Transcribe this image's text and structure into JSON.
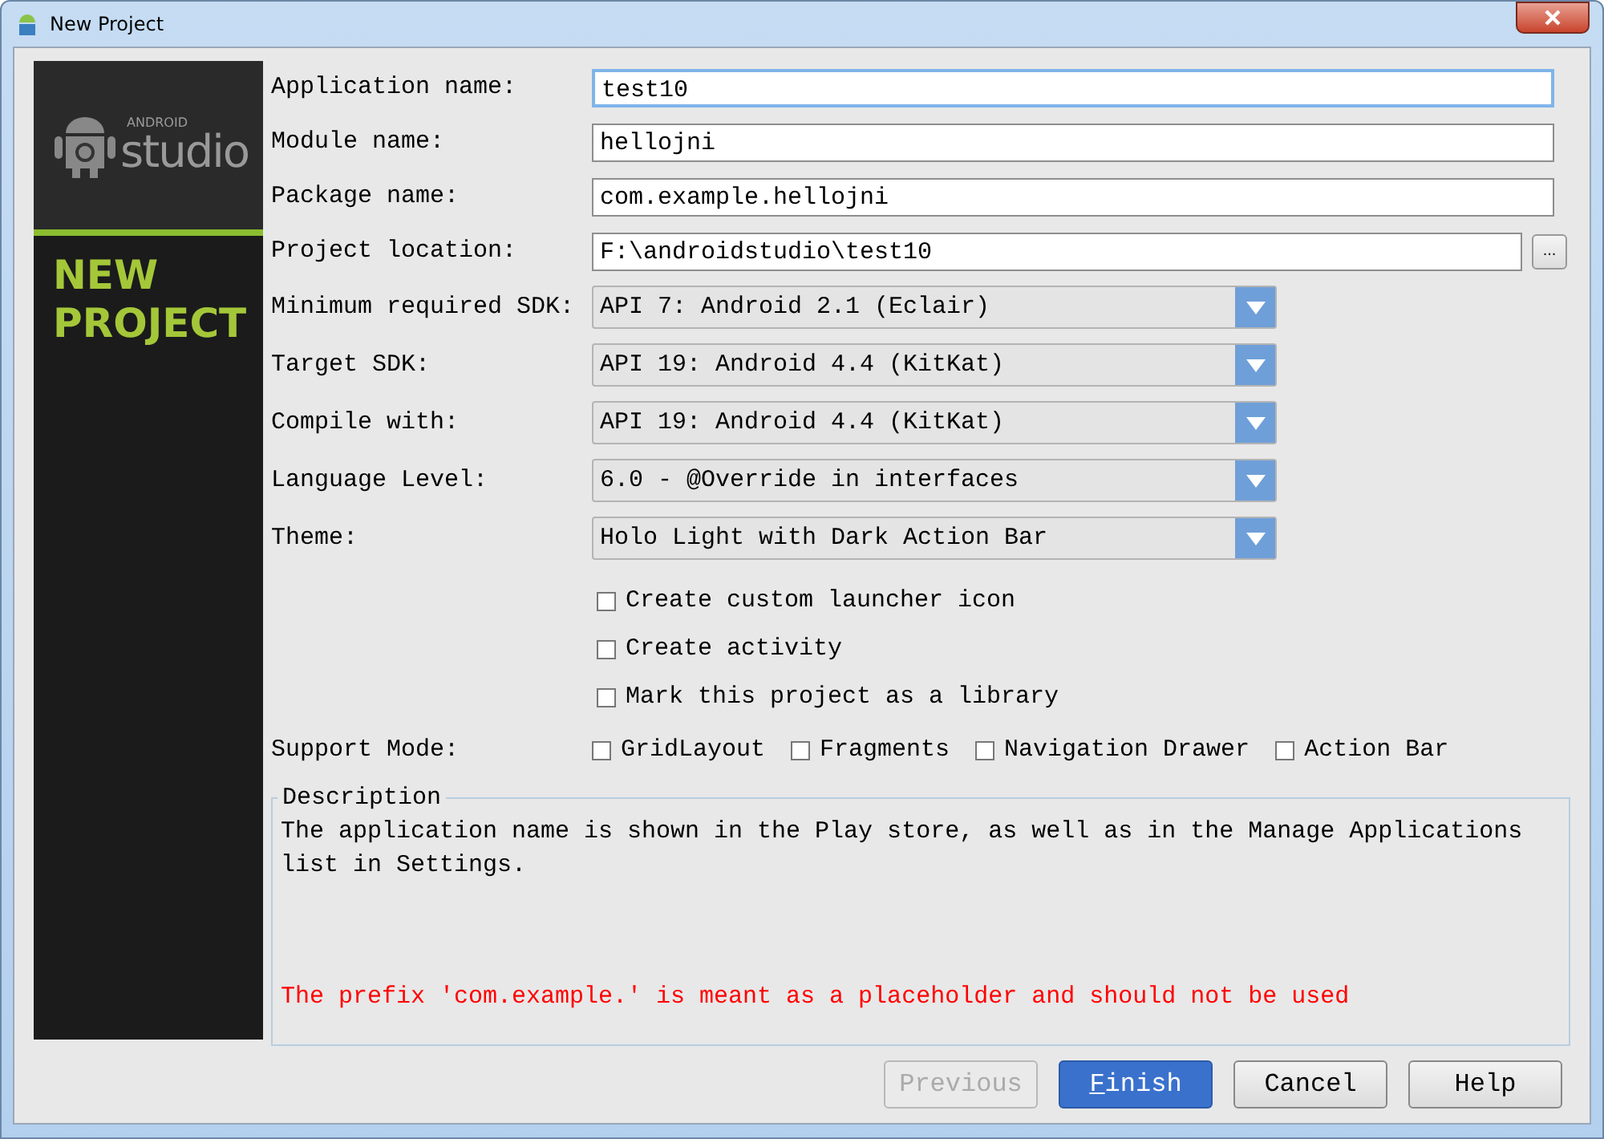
{
  "window": {
    "title": "New Project"
  },
  "banner": {
    "brand_small": "ANDROID",
    "brand": "studio",
    "heading": "NEW PROJECT"
  },
  "fields": [
    {
      "kind": "text",
      "label": "Application name:",
      "value": "test10",
      "focused": true
    },
    {
      "kind": "text",
      "label": "Module name:",
      "value": "hellojni",
      "focused": false
    },
    {
      "kind": "text",
      "label": "Package name:",
      "value": "com.example.hellojni",
      "focused": false
    },
    {
      "kind": "path",
      "label": "Project location:",
      "value": "F:\\androidstudio\\test10",
      "focused": false,
      "browse": "..."
    },
    {
      "kind": "dropdown",
      "label": "Minimum required SDK:",
      "value": "API 7: Android 2.1 (Eclair)",
      "focused": false
    },
    {
      "kind": "dropdown",
      "label": "Target SDK:",
      "value": "API 19: Android 4.4 (KitKat)",
      "focused": false
    },
    {
      "kind": "dropdown",
      "label": "Compile with:",
      "value": "API 19: Android 4.4 (KitKat)",
      "focused": false
    },
    {
      "kind": "dropdown",
      "label": "Language Level:",
      "value": "6.0 - @Override in interfaces",
      "focused": false
    },
    {
      "kind": "dropdown",
      "label": "Theme:",
      "value": "Holo Light with Dark Action Bar",
      "focused": false
    }
  ],
  "options": [
    {
      "label": "Create custom launcher icon",
      "checked": false
    },
    {
      "label": "Create activity",
      "checked": false
    },
    {
      "label": "Mark this project as a library",
      "checked": false
    }
  ],
  "support_mode": {
    "label": "Support Mode:",
    "options": [
      {
        "label": "GridLayout",
        "checked": false
      },
      {
        "label": "Fragments",
        "checked": false
      },
      {
        "label": "Navigation Drawer",
        "checked": false
      },
      {
        "label": "Action Bar",
        "checked": false
      }
    ]
  },
  "description": {
    "title": "Description",
    "text": "The application name is shown in the Play store, as well as in the Manage Applications list in Settings.",
    "warning": "The prefix 'com.example.' is meant as a placeholder and should not be used"
  },
  "buttons": [
    {
      "label": "Previous",
      "disabled": true,
      "default": false,
      "mnemonic": false
    },
    {
      "label": "Finish",
      "disabled": false,
      "default": true,
      "mnemonic": true
    },
    {
      "label": "Cancel",
      "disabled": false,
      "default": false,
      "mnemonic": false
    },
    {
      "label": "Help",
      "disabled": false,
      "default": false,
      "mnemonic": false
    }
  ]
}
